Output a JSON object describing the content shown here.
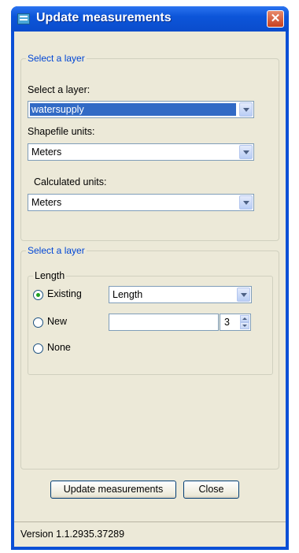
{
  "window": {
    "title": "Update measurements",
    "close_glyph": "✕",
    "icon": "app-icon"
  },
  "group1": {
    "legend": "Select a layer",
    "layer_label": "Select a layer:",
    "layer_value": "watersupply",
    "shapefile_units_label": "Shapefile units:",
    "shapefile_units_value": "Meters",
    "calculated_units_label": "Calculated units:",
    "calculated_units_value": "Meters"
  },
  "group2": {
    "legend": "Select a layer",
    "length_legend": "Length",
    "options": [
      {
        "label": "Existing",
        "checked": true
      },
      {
        "label": "New",
        "checked": false
      },
      {
        "label": "None",
        "checked": false
      }
    ],
    "existing_field_value": "Length",
    "new_field_value": "",
    "decimals_value": "3"
  },
  "buttons": {
    "update_label": "Update measurements",
    "close_label": "Close"
  },
  "status": {
    "version_text": "Version 1.1.2935.37289"
  },
  "colors": {
    "titlebar": "#0c55d9",
    "client": "#ece9d8",
    "legend": "#0046d5",
    "selection": "#316ac5",
    "close": "#c8401e"
  }
}
